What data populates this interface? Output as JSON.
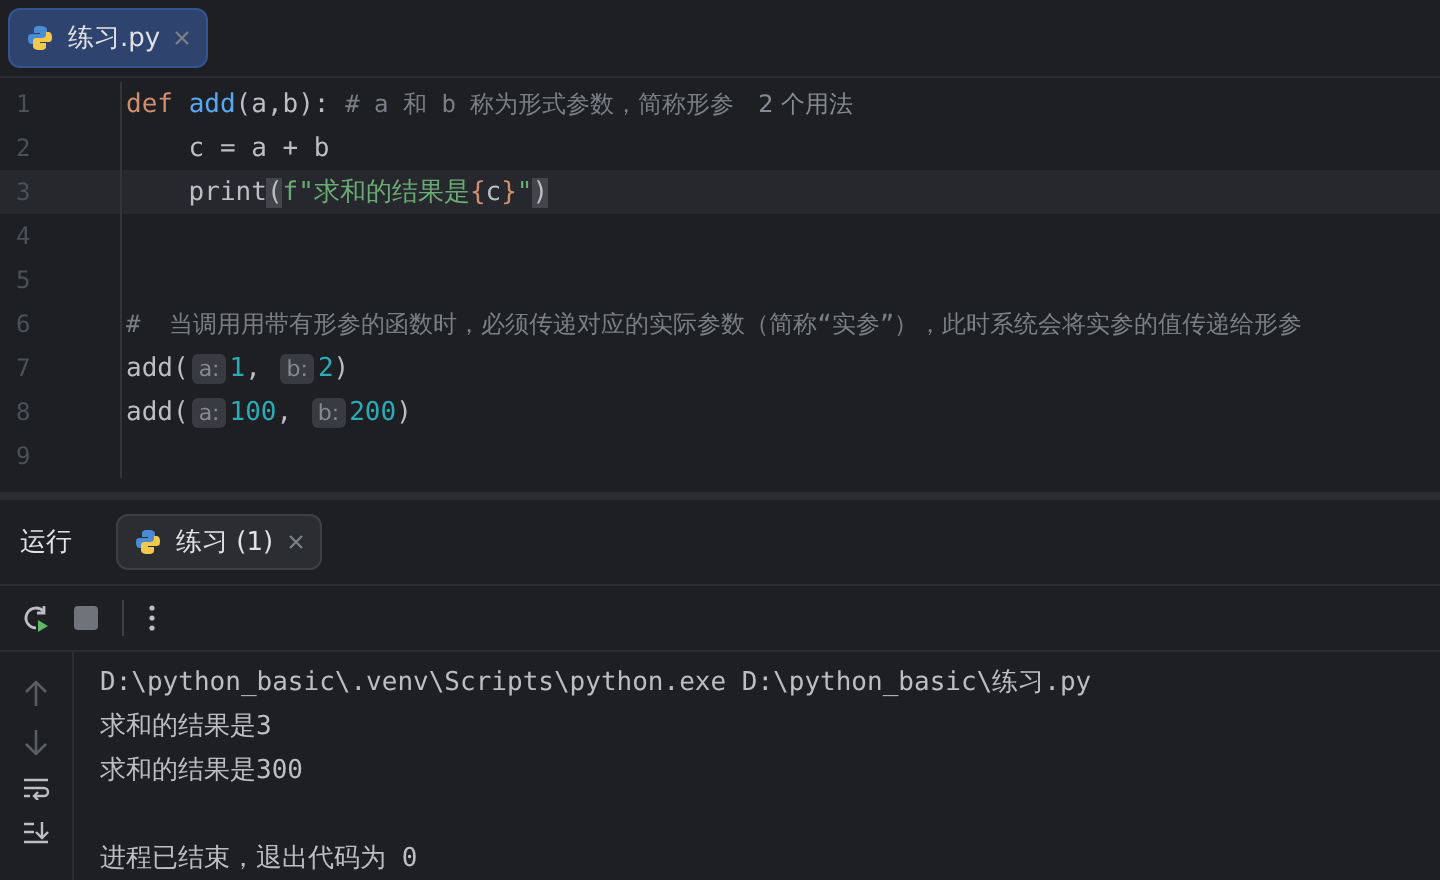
{
  "editor_tabs": [
    {
      "label": "练习.py",
      "selected": true
    }
  ],
  "code_lines": [
    {
      "number": "1",
      "current": false,
      "tokens": [
        {
          "kind": "keyword",
          "text": "def "
        },
        {
          "kind": "function",
          "text": "add"
        },
        {
          "kind": "plain",
          "text": "(a,b): "
        },
        {
          "kind": "comment",
          "text": "# a 和 b 称为形式参数，简称形参"
        },
        {
          "kind": "usage",
          "text": "2 个用法"
        }
      ]
    },
    {
      "number": "2",
      "current": false,
      "tokens": [
        {
          "kind": "plain",
          "text": "    c = a + b"
        }
      ]
    },
    {
      "number": "3",
      "current": true,
      "tokens": [
        {
          "kind": "plain",
          "text": "    print"
        },
        {
          "kind": "brace",
          "text": "("
        },
        {
          "kind": "string",
          "text": "f\"求和的结果是"
        },
        {
          "kind": "keyword",
          "text": "{"
        },
        {
          "kind": "plain",
          "text": "c"
        },
        {
          "kind": "keyword",
          "text": "}"
        },
        {
          "kind": "string",
          "text": "\""
        },
        {
          "kind": "brace",
          "text": ")"
        }
      ]
    },
    {
      "number": "4",
      "current": false
    },
    {
      "number": "5",
      "current": false
    },
    {
      "number": "6",
      "current": false,
      "tokens": [
        {
          "kind": "comment",
          "text": "#  当调用用带有形参的函数时，必须传递对应的实际参数（简称“实参”），此时系统会将实参的值传递给形参"
        }
      ]
    },
    {
      "number": "7",
      "current": false,
      "tokens": [
        {
          "kind": "plain",
          "text": "add("
        },
        {
          "kind": "hint",
          "text": "a:"
        },
        {
          "kind": "number",
          "text": "1"
        },
        {
          "kind": "plain",
          "text": ", "
        },
        {
          "kind": "hint",
          "text": "b:"
        },
        {
          "kind": "number",
          "text": "2"
        },
        {
          "kind": "plain",
          "text": ")"
        }
      ]
    },
    {
      "number": "8",
      "current": false,
      "tokens": [
        {
          "kind": "plain",
          "text": "add("
        },
        {
          "kind": "hint",
          "text": "a:"
        },
        {
          "kind": "number",
          "text": "100"
        },
        {
          "kind": "plain",
          "text": ", "
        },
        {
          "kind": "hint",
          "text": "b:"
        },
        {
          "kind": "number",
          "text": "200"
        },
        {
          "kind": "plain",
          "text": ")"
        }
      ]
    },
    {
      "number": "9",
      "current": false
    }
  ],
  "run_panel": {
    "title": "运行",
    "tabs": [
      {
        "label": "练习 (1)",
        "selected": true
      }
    ],
    "console_lines": [
      "D:\\python_basic\\.venv\\Scripts\\python.exe D:\\python_basic\\练习.py",
      "求和的结果是3",
      "求和的结果是300"
    ],
    "exit_message": "进程已结束，退出代码为 0"
  }
}
